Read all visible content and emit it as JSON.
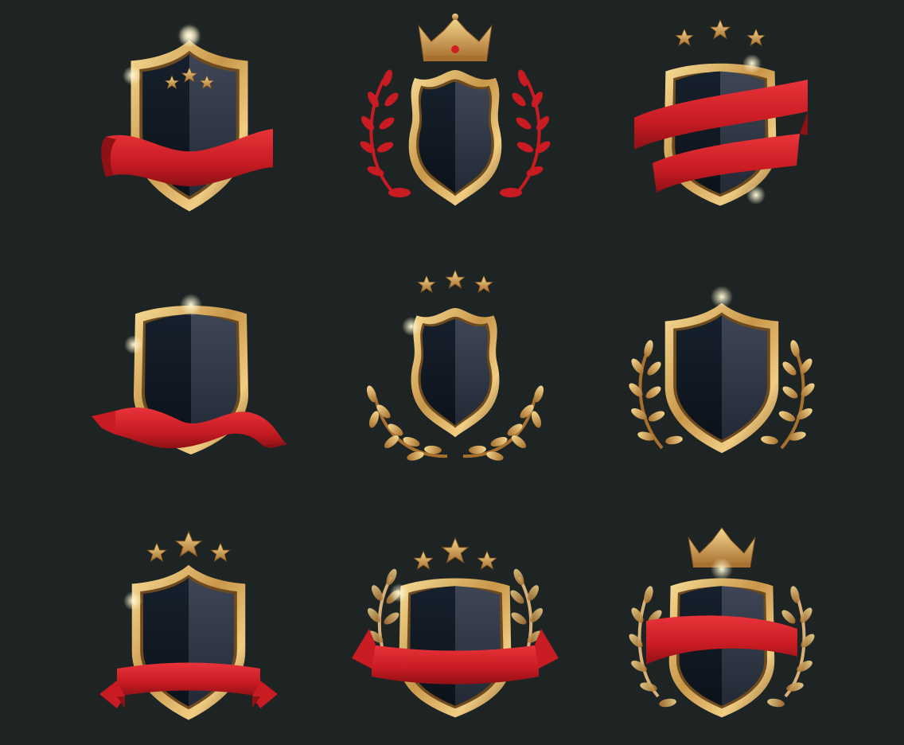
{
  "colors": {
    "background": "#1d2423",
    "gold_light": "#f3d48a",
    "gold_mid": "#c9974a",
    "gold_dark": "#8a5a22",
    "shield_dark": "#121a24",
    "shield_light": "#3a4150",
    "ribbon": "#d11f25",
    "ribbon_dark": "#8e1116"
  },
  "badges": [
    {
      "name": "badge-shield-stars-ribbon",
      "top": "stars-inner",
      "ribbon": "wave",
      "wreath": "none"
    },
    {
      "name": "badge-shield-crown-red-wreath",
      "top": "crown",
      "ribbon": "none",
      "wreath": "red"
    },
    {
      "name": "badge-shield-stars-double-ribbon",
      "top": "stars",
      "ribbon": "double",
      "wreath": "none"
    },
    {
      "name": "badge-shield-wave-ribbon",
      "top": "none",
      "ribbon": "wide-wave",
      "wreath": "none"
    },
    {
      "name": "badge-shield-stars-bottom-wreath",
      "top": "stars",
      "ribbon": "none",
      "wreath": "gold-bottom"
    },
    {
      "name": "badge-shield-side-wreath",
      "top": "none",
      "ribbon": "none",
      "wreath": "gold-side"
    },
    {
      "name": "badge-shield-stars-banner",
      "top": "stars-big",
      "ribbon": "banner",
      "wreath": "none"
    },
    {
      "name": "badge-shield-stars-wreath-banner",
      "top": "stars-big",
      "ribbon": "banner-wide",
      "wreath": "gold-top"
    },
    {
      "name": "badge-shield-crown-wreath-ribbon",
      "top": "crown-gold",
      "ribbon": "straight",
      "wreath": "gold-side"
    }
  ]
}
